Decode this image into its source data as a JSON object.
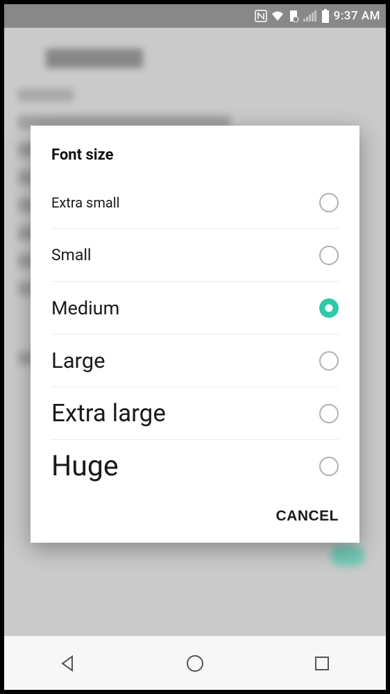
{
  "status": {
    "time": "9:37 AM"
  },
  "dialog": {
    "title": "Font size",
    "options": [
      {
        "label": "Extra small",
        "selected": false
      },
      {
        "label": "Small",
        "selected": false
      },
      {
        "label": "Medium",
        "selected": true
      },
      {
        "label": "Large",
        "selected": false
      },
      {
        "label": "Extra large",
        "selected": false
      },
      {
        "label": "Huge",
        "selected": false
      }
    ],
    "cancel_label": "CANCEL"
  }
}
